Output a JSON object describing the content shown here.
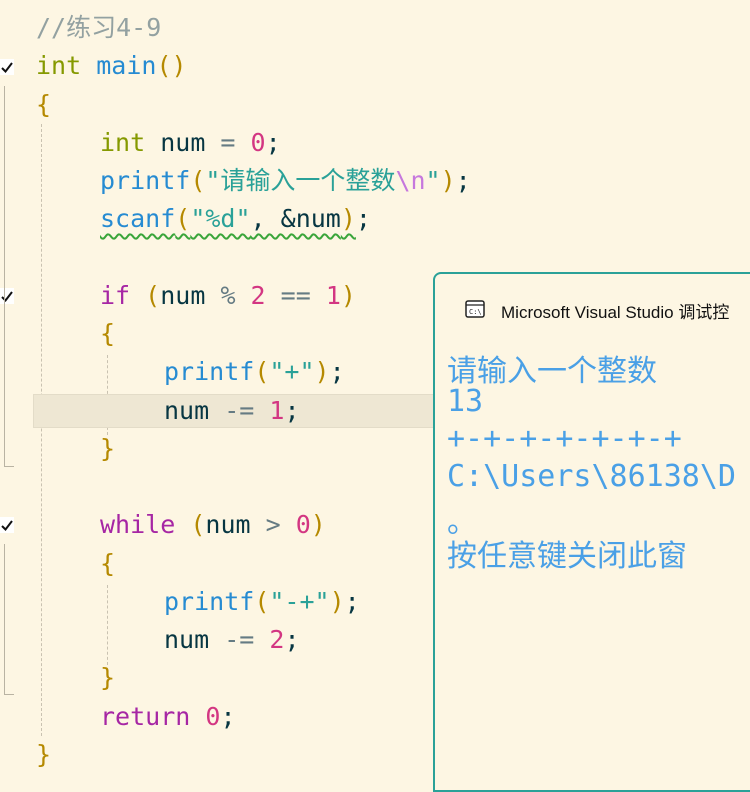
{
  "editor": {
    "lines": {
      "l1": "//练习4-9",
      "l2_type": "int",
      "l2_fn": "main",
      "l2_paren": "()",
      "l3": "{",
      "l4_type": "int",
      "l4_var": "num",
      "l4_eq": " = ",
      "l4_num": "0",
      "l4_semi": ";",
      "l5_fn": "printf",
      "l5_p1": "(",
      "l5_str": "\"请输入一个整数",
      "l5_esc": "\\n",
      "l5_str2": "\"",
      "l5_p2": ")",
      "l5_semi": ";",
      "l6_fn": "scanf",
      "l6_p1": "(",
      "l6_str": "\"%d\"",
      "l6_rest": ", &num",
      "l6_p2": ")",
      "l6_semi": ";",
      "l8_kw": "if",
      "l8_p1": "(",
      "l8_var": "num",
      "l8_op1": " % ",
      "l8_num1": "2",
      "l8_op2": " == ",
      "l8_num2": "1",
      "l8_p2": ")",
      "l9": "{",
      "l10_fn": "printf",
      "l10_p1": "(",
      "l10_str": "\"+\"",
      "l10_p2": ")",
      "l10_semi": ";",
      "l11_var": "num",
      "l11_op": " -= ",
      "l11_num": "1",
      "l11_semi": ";",
      "l12": "}",
      "l14_kw": "while",
      "l14_p1": "(",
      "l14_var": "num",
      "l14_op": " > ",
      "l14_num": "0",
      "l14_p2": ")",
      "l15": "{",
      "l16_fn": "printf",
      "l16_p1": "(",
      "l16_str": "\"-+\"",
      "l16_p2": ")",
      "l16_semi": ";",
      "l17_var": "num",
      "l17_op": " -= ",
      "l17_num": "2",
      "l17_semi": ";",
      "l18": "}",
      "l19_kw": "return",
      "l19_num": "0",
      "l19_semi": ";",
      "l20": "}"
    }
  },
  "console": {
    "title": "Microsoft Visual Studio 调试控",
    "output": [
      "请输入一个整数",
      "13",
      "+-+-+-+-+-+-+",
      "C:\\Users\\86138\\D",
      "。",
      "按任意键关闭此窗"
    ]
  },
  "colors": {
    "background": "#fdf6e3",
    "console_border": "#2aa198",
    "console_text": "#4aa0e6"
  }
}
